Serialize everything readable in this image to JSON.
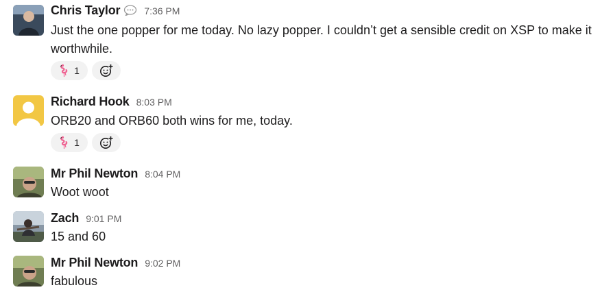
{
  "messages": [
    {
      "name": "Chris Taylor",
      "time": "7:36 PM",
      "avatar_icon": "user-photo-chris",
      "status_icon": "speech-bubble-icon",
      "text": "Just the one popper for me today. No lazy popper. I couldn’t get a sensible credit on XSP to make it worthwhile.",
      "reactions": [
        {
          "emoji": "flamingo-icon",
          "count": "1"
        }
      ]
    },
    {
      "name": "Richard Hook",
      "time": "8:03 PM",
      "avatar_icon": "default-avatar-yellow",
      "text": "ORB20 and ORB60 both wins for me, today.",
      "reactions": [
        {
          "emoji": "flamingo-icon",
          "count": "1"
        }
      ]
    },
    {
      "name": "Mr Phil Newton",
      "time": "8:04 PM",
      "avatar_icon": "user-photo-phil",
      "text": "Woot woot"
    },
    {
      "name": "Zach",
      "time": "9:01 PM",
      "avatar_icon": "user-photo-zach",
      "text": "15 and 60"
    },
    {
      "name": "Mr Phil Newton",
      "time": "9:02 PM",
      "avatar_icon": "user-photo-phil",
      "text": "fabulous"
    }
  ],
  "colors": {
    "name_text": "#1d1c1d",
    "timestamp": "#616061",
    "reaction_bg": "#f2f2f2",
    "flamingo": "#f06292",
    "default_avatar": "#f2c744"
  }
}
